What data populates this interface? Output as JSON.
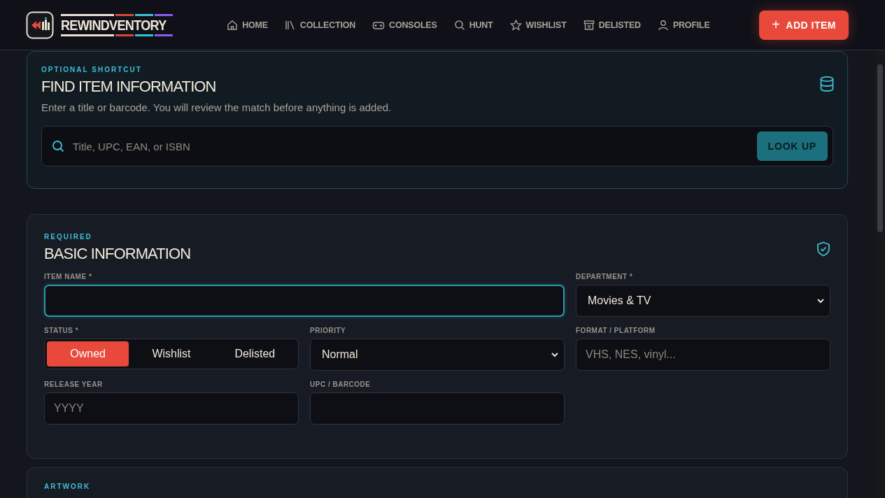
{
  "header": {
    "logo_text": "REWINDVENTORY",
    "nav": [
      {
        "label": "HOME"
      },
      {
        "label": "COLLECTION"
      },
      {
        "label": "CONSOLES"
      },
      {
        "label": "HUNT"
      },
      {
        "label": "WISHLIST"
      },
      {
        "label": "DELISTED"
      },
      {
        "label": "PROFILE"
      }
    ],
    "add_button": {
      "icon": "+",
      "label": "ADD ITEM"
    }
  },
  "lookup": {
    "eyebrow": "OPTIONAL SHORTCUT",
    "title": "FIND ITEM INFORMATION",
    "description": "Enter a title or barcode. You will review the match before anything is added.",
    "search": {
      "placeholder": "Title, UPC, EAN, or ISBN"
    },
    "button": "LOOK UP"
  },
  "basic": {
    "eyebrow": "REQUIRED",
    "title": "BASIC INFORMATION",
    "fields": [
      {
        "kind": "text",
        "label": "ITEM NAME *",
        "focused": true,
        "wide": true
      },
      {
        "kind": "select",
        "label": "DEPARTMENT *",
        "value": "Movies & TV"
      },
      {
        "kind": "segmented",
        "label": "STATUS *",
        "options": [
          {
            "label": "Owned",
            "selected": true
          },
          {
            "label": "Wishlist",
            "selected": false
          },
          {
            "label": "Delisted",
            "selected": false
          }
        ]
      },
      {
        "kind": "select",
        "label": "PRIORITY",
        "value": "Normal"
      },
      {
        "kind": "text",
        "label": "FORMAT / PLATFORM",
        "placeholder": "VHS, NES, vinyl..."
      },
      {
        "kind": "text",
        "label": "RELEASE YEAR",
        "placeholder": "YYYY"
      },
      {
        "kind": "text",
        "label": "UPC / BARCODE"
      }
    ]
  },
  "artwork": {
    "eyebrow": "ARTWORK"
  }
}
